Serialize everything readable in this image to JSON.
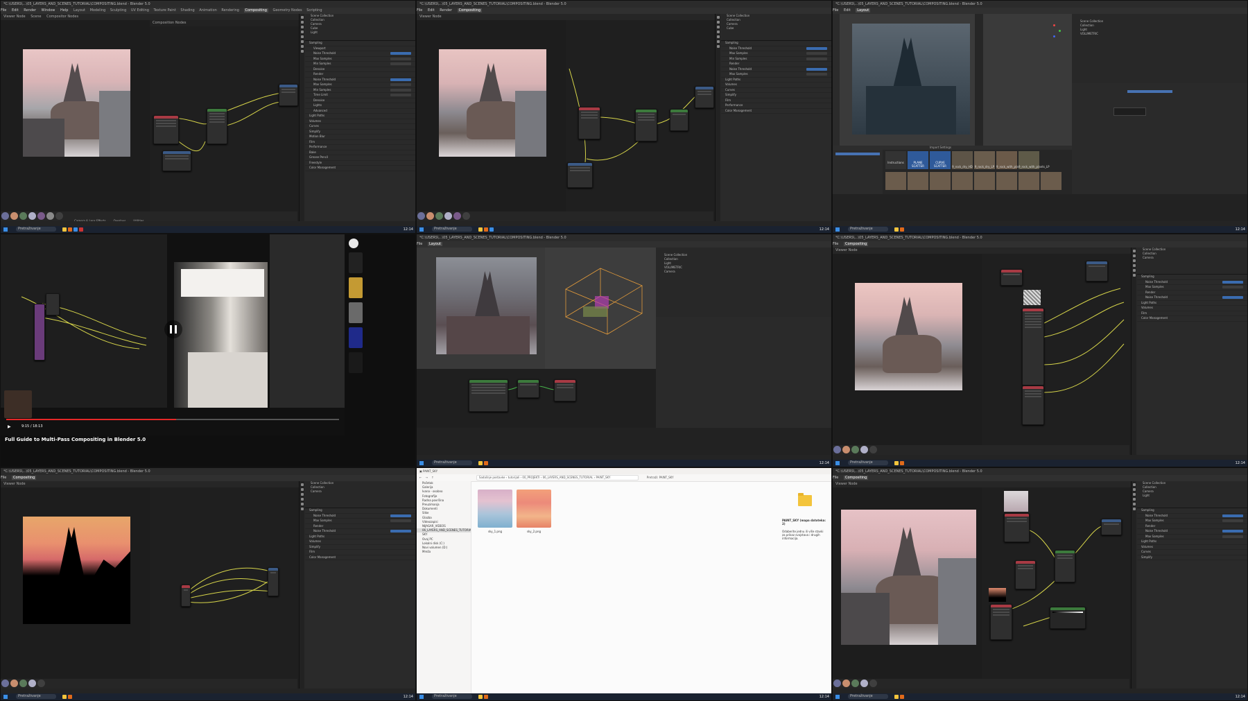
{
  "screen": {
    "app_title": "*C:\\USERS\\...\\05_LAYERS_AND_SCENES_TUTORIAL\\COMPOSITING.blend - Blender 5.0",
    "menu": [
      "File",
      "Edit",
      "Render",
      "Window",
      "Help"
    ],
    "workspaces": [
      "Layout",
      "Modeling",
      "Sculpting",
      "UV Editing",
      "Texture Paint",
      "Shading",
      "Animation",
      "Rendering",
      "Compositing",
      "Geometry Nodes",
      "Scripting"
    ],
    "active_workspace": "Compositing",
    "scene_label": "Scene",
    "viewlayer_label": "ViewLayer",
    "viewer_label": "Viewer Node",
    "node_tree_label": "Composition Nodes",
    "compositor_label": "Compositor Nodes",
    "outliner_items": [
      "Scene Collection",
      "Collection",
      "Camera",
      "Cube",
      "Light",
      "VOLUMETRIC"
    ],
    "sampling_panel": {
      "title": "Sampling",
      "rows": [
        "Viewport",
        "Noise Threshold",
        "Max Samples",
        "Min Samples",
        "Denoise",
        "Render",
        "Noise Threshold",
        "Max Samples",
        "Min Samples",
        "Time Limit",
        "Denoise",
        "Lights",
        "Advanced",
        "Light Paths",
        "Volumes",
        "Curves",
        "Simplify",
        "Motion Blur",
        "Film",
        "Performance",
        "Bake",
        "Grease Pencil",
        "Freestyle",
        "Color Management"
      ]
    },
    "tray_labels": [
      "Camera & Lens Effects",
      "Overlays",
      "Utilities"
    ],
    "taskbar_search": "Pretraživanje",
    "clock": "12:14"
  },
  "video": {
    "title": "Full Guide to Multi-Pass Compositing in Blender 5.0",
    "time": "9:15 / 18:13",
    "progress": 0.51
  },
  "asset_browser": {
    "header": "Import Settings",
    "items": [
      "Instructions",
      "PLANE SCATTER",
      "CURVE SCATTER",
      "9_rock_dry_HD",
      "9_rock_dry_LP",
      "9_rock_with_plants_HD",
      "9_rock_with_plants_LP"
    ]
  },
  "explorer": {
    "path": "Sadašnje postavke  ›  tutorijali  ›  00_PROJEKTI  ›  06_LAYERS_AND_SCENES_TUTORIAL  ›  PAINT_SKY",
    "search_placeholder": "Pretraži: PAINT_SKY",
    "nav_items": [
      "Početak",
      "Galerija",
      "Ivana - osobno",
      "Fotografije",
      "Radna površina",
      "Preuzimanja",
      "Dokumenti",
      "Slike",
      "Glazba",
      "Videozapisi",
      "NIJAGAR_VIDEOS",
      "06_LAYERS_AND_SCENES_TUTORIAL",
      "SKY",
      "Ovaj PC",
      "Lokalni disk (C:)",
      "Novi volumen (D:)",
      "Mreža"
    ],
    "selected_nav": "06_LAYERS_AND_SCENES_TUTORIAL",
    "files": [
      "sky_1.png",
      "sky_2.png"
    ],
    "detail_title": "PAINT_SKY (mapa datoteka: 2)",
    "detail_text": "Odaberite jednu ili više stavki za prikaz svojstava i drugih informacija."
  },
  "colors": {
    "accent": "#4772b3",
    "wire_yellow": "#d8d64a",
    "node_blue": "#3b5a86",
    "node_red": "#a83a44",
    "node_green": "#3c7a3c"
  }
}
